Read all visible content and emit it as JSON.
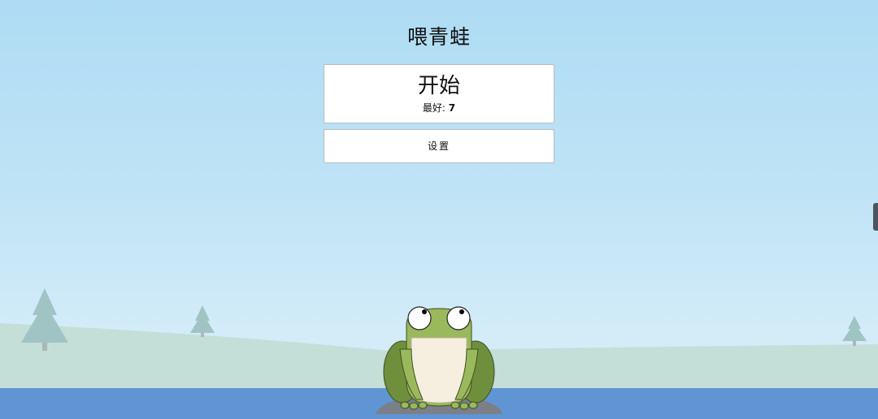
{
  "title": "喂青蛙",
  "start_button": {
    "label": "开始",
    "best_label": "最好:",
    "best_score": "7"
  },
  "settings_button": {
    "label": "设置"
  },
  "colors": {
    "sky_top": "#aedcf4",
    "hill": "#c4ded8",
    "water": "#5f95d3",
    "tree": "#a0c4c4",
    "frog_body": "#9ab95c",
    "frog_dark": "#6f8f3c",
    "frog_belly": "#f6efe0",
    "rock": "#7a7f88"
  },
  "icons": [
    "frog-character",
    "pine-tree",
    "lily-rock"
  ]
}
